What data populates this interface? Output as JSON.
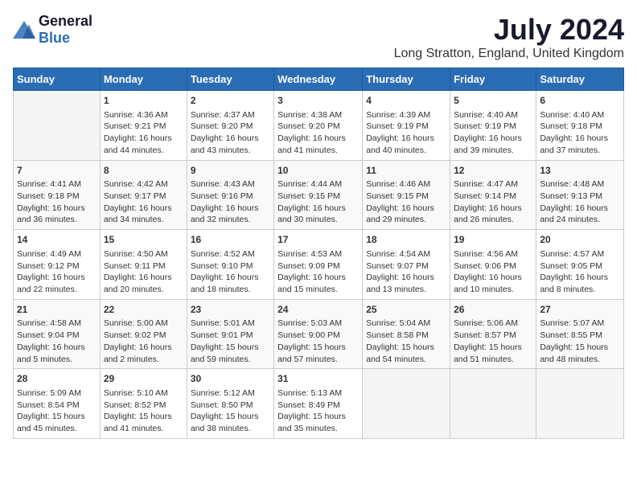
{
  "logo": {
    "general": "General",
    "blue": "Blue"
  },
  "title": "July 2024",
  "subtitle": "Long Stratton, England, United Kingdom",
  "days_header": [
    "Sunday",
    "Monday",
    "Tuesday",
    "Wednesday",
    "Thursday",
    "Friday",
    "Saturday"
  ],
  "weeks": [
    [
      {
        "day": "",
        "info": ""
      },
      {
        "day": "1",
        "info": "Sunrise: 4:36 AM\nSunset: 9:21 PM\nDaylight: 16 hours\nand 44 minutes."
      },
      {
        "day": "2",
        "info": "Sunrise: 4:37 AM\nSunset: 9:20 PM\nDaylight: 16 hours\nand 43 minutes."
      },
      {
        "day": "3",
        "info": "Sunrise: 4:38 AM\nSunset: 9:20 PM\nDaylight: 16 hours\nand 41 minutes."
      },
      {
        "day": "4",
        "info": "Sunrise: 4:39 AM\nSunset: 9:19 PM\nDaylight: 16 hours\nand 40 minutes."
      },
      {
        "day": "5",
        "info": "Sunrise: 4:40 AM\nSunset: 9:19 PM\nDaylight: 16 hours\nand 39 minutes."
      },
      {
        "day": "6",
        "info": "Sunrise: 4:40 AM\nSunset: 9:18 PM\nDaylight: 16 hours\nand 37 minutes."
      }
    ],
    [
      {
        "day": "7",
        "info": "Sunrise: 4:41 AM\nSunset: 9:18 PM\nDaylight: 16 hours\nand 36 minutes."
      },
      {
        "day": "8",
        "info": "Sunrise: 4:42 AM\nSunset: 9:17 PM\nDaylight: 16 hours\nand 34 minutes."
      },
      {
        "day": "9",
        "info": "Sunrise: 4:43 AM\nSunset: 9:16 PM\nDaylight: 16 hours\nand 32 minutes."
      },
      {
        "day": "10",
        "info": "Sunrise: 4:44 AM\nSunset: 9:15 PM\nDaylight: 16 hours\nand 30 minutes."
      },
      {
        "day": "11",
        "info": "Sunrise: 4:46 AM\nSunset: 9:15 PM\nDaylight: 16 hours\nand 29 minutes."
      },
      {
        "day": "12",
        "info": "Sunrise: 4:47 AM\nSunset: 9:14 PM\nDaylight: 16 hours\nand 26 minutes."
      },
      {
        "day": "13",
        "info": "Sunrise: 4:48 AM\nSunset: 9:13 PM\nDaylight: 16 hours\nand 24 minutes."
      }
    ],
    [
      {
        "day": "14",
        "info": "Sunrise: 4:49 AM\nSunset: 9:12 PM\nDaylight: 16 hours\nand 22 minutes."
      },
      {
        "day": "15",
        "info": "Sunrise: 4:50 AM\nSunset: 9:11 PM\nDaylight: 16 hours\nand 20 minutes."
      },
      {
        "day": "16",
        "info": "Sunrise: 4:52 AM\nSunset: 9:10 PM\nDaylight: 16 hours\nand 18 minutes."
      },
      {
        "day": "17",
        "info": "Sunrise: 4:53 AM\nSunset: 9:09 PM\nDaylight: 16 hours\nand 15 minutes."
      },
      {
        "day": "18",
        "info": "Sunrise: 4:54 AM\nSunset: 9:07 PM\nDaylight: 16 hours\nand 13 minutes."
      },
      {
        "day": "19",
        "info": "Sunrise: 4:56 AM\nSunset: 9:06 PM\nDaylight: 16 hours\nand 10 minutes."
      },
      {
        "day": "20",
        "info": "Sunrise: 4:57 AM\nSunset: 9:05 PM\nDaylight: 16 hours\nand 8 minutes."
      }
    ],
    [
      {
        "day": "21",
        "info": "Sunrise: 4:58 AM\nSunset: 9:04 PM\nDaylight: 16 hours\nand 5 minutes."
      },
      {
        "day": "22",
        "info": "Sunrise: 5:00 AM\nSunset: 9:02 PM\nDaylight: 16 hours\nand 2 minutes."
      },
      {
        "day": "23",
        "info": "Sunrise: 5:01 AM\nSunset: 9:01 PM\nDaylight: 15 hours\nand 59 minutes."
      },
      {
        "day": "24",
        "info": "Sunrise: 5:03 AM\nSunset: 9:00 PM\nDaylight: 15 hours\nand 57 minutes."
      },
      {
        "day": "25",
        "info": "Sunrise: 5:04 AM\nSunset: 8:58 PM\nDaylight: 15 hours\nand 54 minutes."
      },
      {
        "day": "26",
        "info": "Sunrise: 5:06 AM\nSunset: 8:57 PM\nDaylight: 15 hours\nand 51 minutes."
      },
      {
        "day": "27",
        "info": "Sunrise: 5:07 AM\nSunset: 8:55 PM\nDaylight: 15 hours\nand 48 minutes."
      }
    ],
    [
      {
        "day": "28",
        "info": "Sunrise: 5:09 AM\nSunset: 8:54 PM\nDaylight: 15 hours\nand 45 minutes."
      },
      {
        "day": "29",
        "info": "Sunrise: 5:10 AM\nSunset: 8:52 PM\nDaylight: 15 hours\nand 41 minutes."
      },
      {
        "day": "30",
        "info": "Sunrise: 5:12 AM\nSunset: 8:50 PM\nDaylight: 15 hours\nand 38 minutes."
      },
      {
        "day": "31",
        "info": "Sunrise: 5:13 AM\nSunset: 8:49 PM\nDaylight: 15 hours\nand 35 minutes."
      },
      {
        "day": "",
        "info": ""
      },
      {
        "day": "",
        "info": ""
      },
      {
        "day": "",
        "info": ""
      }
    ]
  ]
}
